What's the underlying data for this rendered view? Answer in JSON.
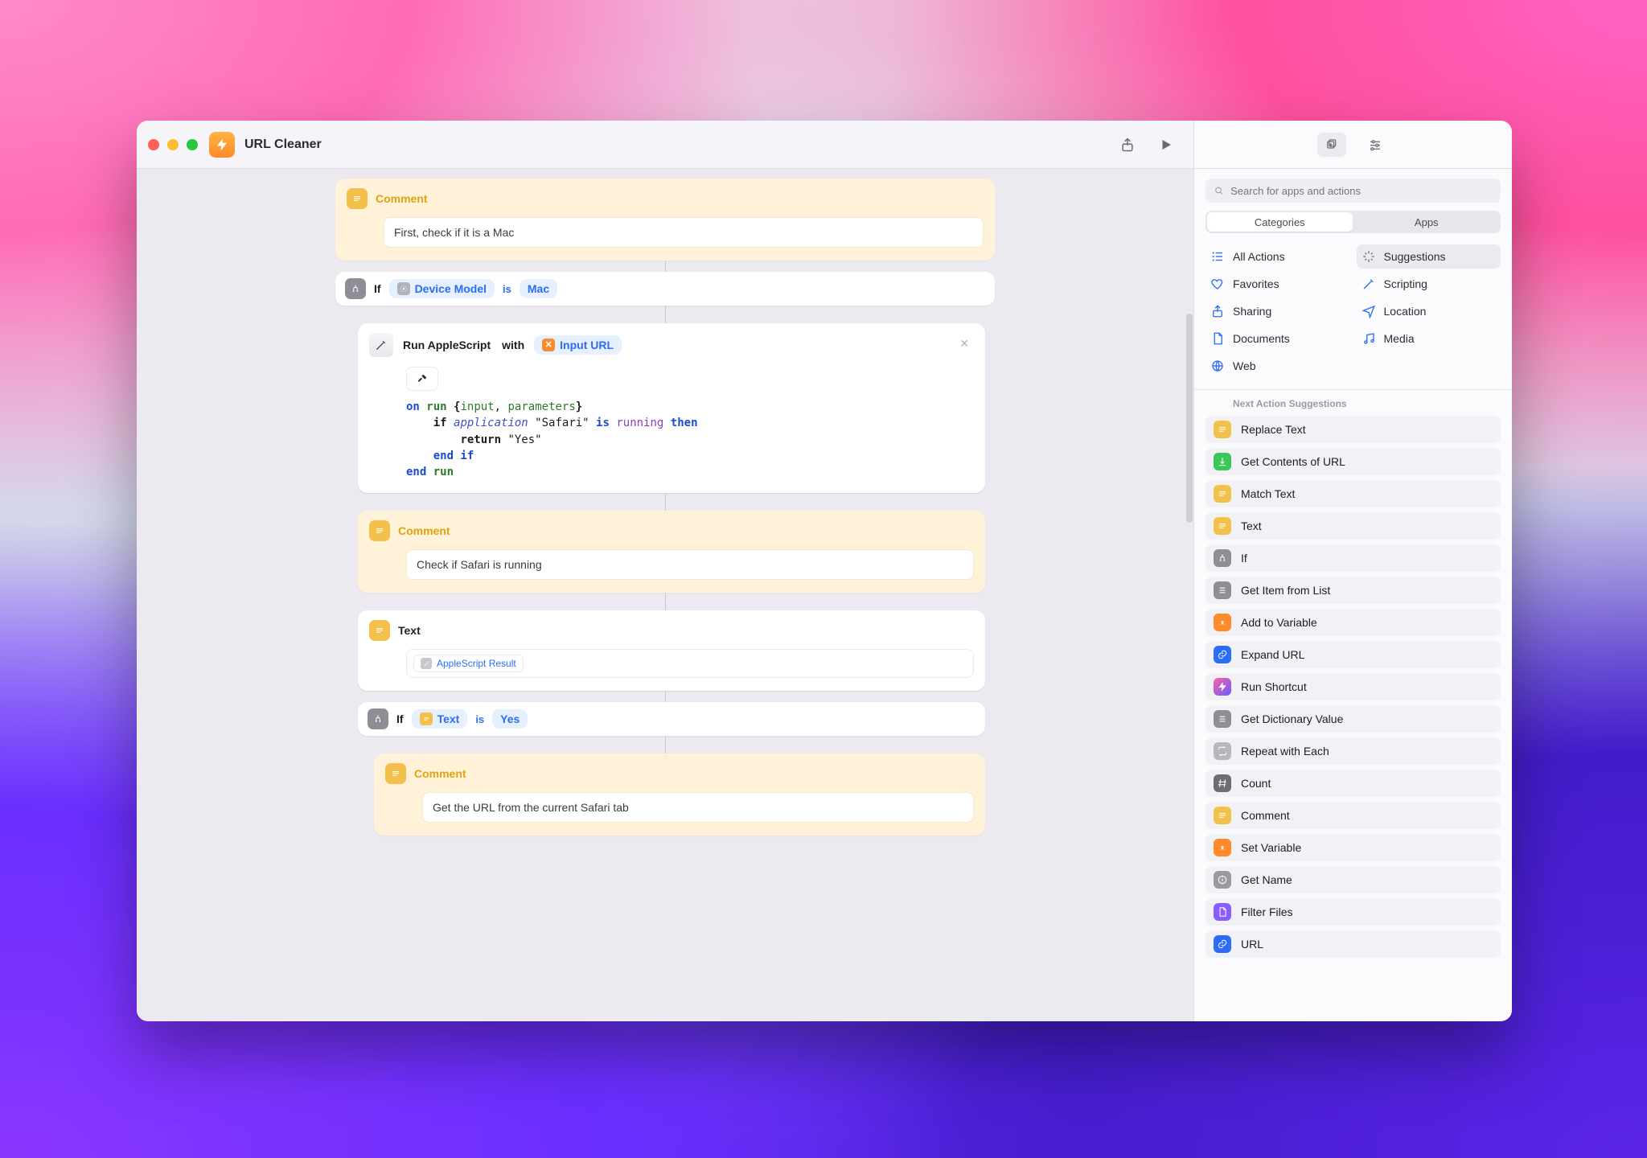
{
  "window": {
    "title": "URL Cleaner"
  },
  "toolbar": {
    "share_tooltip": "Share",
    "run_tooltip": "Run"
  },
  "editor": {
    "comment1": {
      "label": "Comment",
      "text": "First, check if it is a Mac"
    },
    "if1": {
      "if": "If",
      "var": "Device Model",
      "op": "is",
      "value": "Mac"
    },
    "script": {
      "prefix": "Run AppleScript",
      "with": "with",
      "input_pill": "Input URL",
      "code": {
        "l1_on": "on",
        "l1_run": "run",
        "l1_input": "input",
        "l1_params": "parameters",
        "l2_if": "if",
        "l2_app": "application",
        "l2_safari": "\"Safari\"",
        "l2_is": "is",
        "l2_running": "running",
        "l2_then": "then",
        "l3_return": "return",
        "l3_yes": "\"Yes\"",
        "l4_endif": "end if",
        "l5_end": "end",
        "l5_run": "run"
      }
    },
    "comment2": {
      "label": "Comment",
      "text": "Check if Safari is running"
    },
    "textAction": {
      "label": "Text",
      "var": "AppleScript Result"
    },
    "if2": {
      "if": "If",
      "var": "Text",
      "op": "is",
      "value": "Yes"
    },
    "comment3": {
      "label": "Comment",
      "text": "Get the URL from the current Safari tab"
    }
  },
  "right": {
    "search_placeholder": "Search for apps and actions",
    "seg": {
      "categories": "Categories",
      "apps": "Apps"
    },
    "categories": [
      {
        "key": "all",
        "label": "All Actions"
      },
      {
        "key": "suggestions",
        "label": "Suggestions",
        "selected": true
      },
      {
        "key": "favorites",
        "label": "Favorites"
      },
      {
        "key": "scripting",
        "label": "Scripting"
      },
      {
        "key": "sharing",
        "label": "Sharing"
      },
      {
        "key": "location",
        "label": "Location"
      },
      {
        "key": "documents",
        "label": "Documents"
      },
      {
        "key": "media",
        "label": "Media"
      },
      {
        "key": "web",
        "label": "Web"
      }
    ],
    "suggest_title": "Next Action Suggestions",
    "suggestions": [
      {
        "label": "Replace Text",
        "color": "bg-yellow",
        "icon": "text"
      },
      {
        "label": "Get Contents of URL",
        "color": "bg-green",
        "icon": "download"
      },
      {
        "label": "Match Text",
        "color": "bg-yellow",
        "icon": "text"
      },
      {
        "label": "Text",
        "color": "bg-yellow",
        "icon": "text"
      },
      {
        "label": "If",
        "color": "bg-gray",
        "icon": "branch"
      },
      {
        "label": "Get Item from List",
        "color": "bg-gray",
        "icon": "list"
      },
      {
        "label": "Add to Variable",
        "color": "bg-orange",
        "icon": "x"
      },
      {
        "label": "Expand URL",
        "color": "bg-blue",
        "icon": "link"
      },
      {
        "label": "Run Shortcut",
        "color": "bg-grad",
        "icon": "bolt"
      },
      {
        "label": "Get Dictionary Value",
        "color": "bg-gray",
        "icon": "list"
      },
      {
        "label": "Repeat with Each",
        "color": "bg-ltgray",
        "icon": "repeat"
      },
      {
        "label": "Count",
        "color": "bg-dkgray",
        "icon": "hash"
      },
      {
        "label": "Comment",
        "color": "bg-yellow",
        "icon": "quote"
      },
      {
        "label": "Set Variable",
        "color": "bg-orange",
        "icon": "x"
      },
      {
        "label": "Get Name",
        "color": "bg-gray2",
        "icon": "info"
      },
      {
        "label": "Filter Files",
        "color": "bg-purple",
        "icon": "file"
      },
      {
        "label": "URL",
        "color": "bg-blue",
        "icon": "link"
      }
    ]
  }
}
